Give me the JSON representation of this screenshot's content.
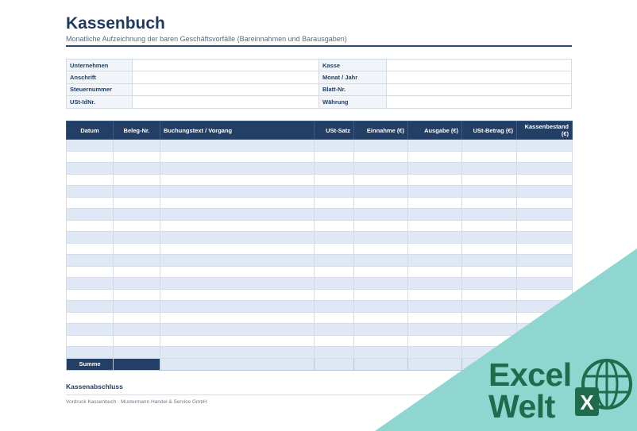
{
  "header": {
    "title": "Kassenbuch",
    "subtitle": "Monatliche Aufzeichnung der baren Geschäftsvorfälle (Bareinnahmen und Barausgaben)"
  },
  "info": {
    "rows": [
      {
        "left_label": "Unternehmen",
        "right_label": "Kasse"
      },
      {
        "left_label": "Anschrift",
        "right_label": "Monat / Jahr"
      },
      {
        "left_label": "Steuernummer",
        "right_label": "Blatt-Nr."
      },
      {
        "left_label": "USt-IdNr.",
        "right_label": "Währung"
      }
    ]
  },
  "ledger": {
    "columns": [
      "Datum",
      "Beleg-Nr.",
      "Buchungstext / Vorgang",
      "USt-Satz",
      "Einnahme (€)",
      "Ausgabe (€)",
      "USt-Betrag (€)",
      "Kassenbestand (€)"
    ],
    "empty_row_count": 19,
    "sum_label": "Summe"
  },
  "closing": {
    "label": "Kassenabschluss"
  },
  "footer": {
    "text": "Vordruck Kassenbuch · Mustermann Handel & Service GmbH"
  },
  "watermark": {
    "line1": "Excel",
    "line2": "Welt",
    "badge": "X",
    "colors": {
      "triangle": "#8fd6d0",
      "text": "#1f6b4c"
    }
  }
}
